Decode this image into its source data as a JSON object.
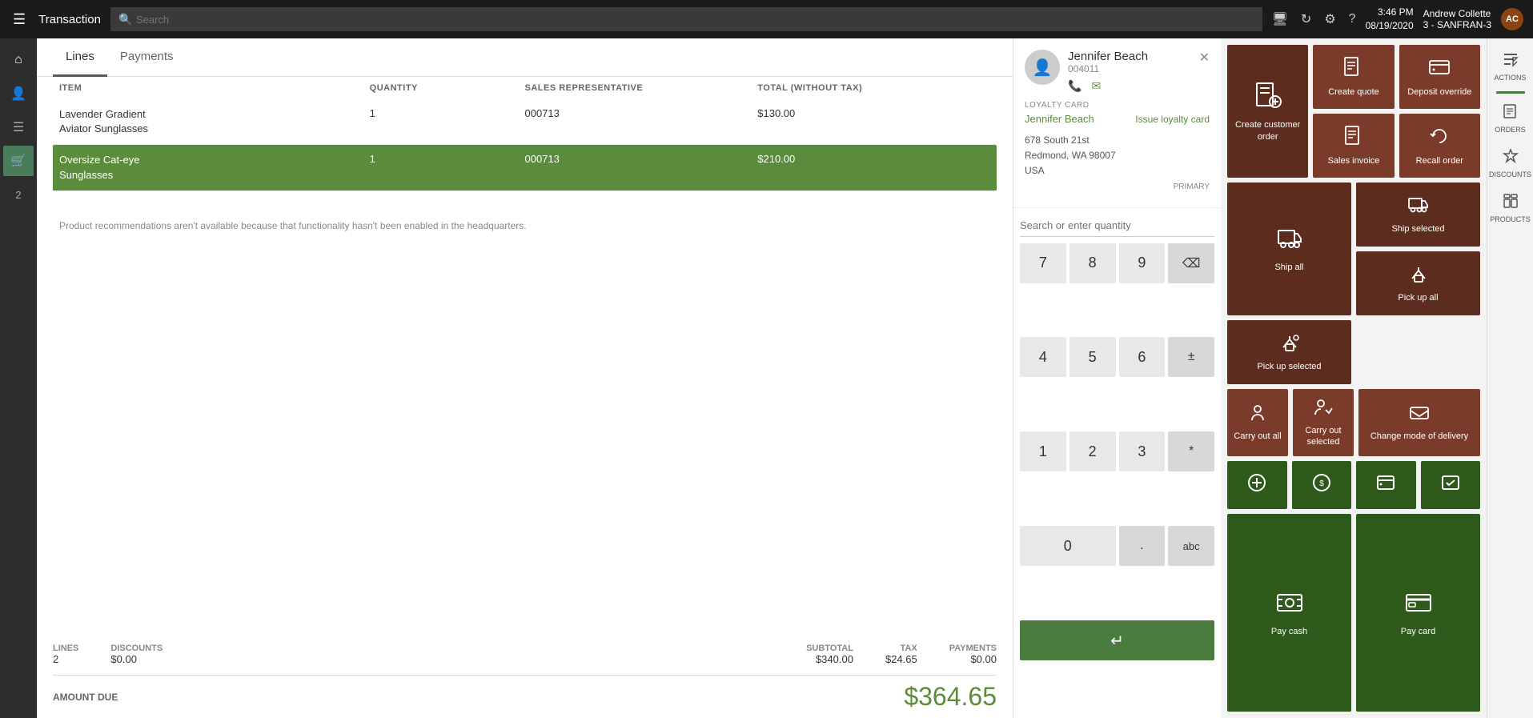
{
  "topbar": {
    "hamburger": "☰",
    "title": "Transaction",
    "search_placeholder": "Search",
    "time": "3:46 PM",
    "date": "08/19/2020",
    "user": "Andrew Collette",
    "store": "3 - SANFRAN-3",
    "avatar": "AC"
  },
  "tabs": [
    {
      "id": "lines",
      "label": "Lines",
      "active": true
    },
    {
      "id": "payments",
      "label": "Payments",
      "active": false
    }
  ],
  "lines_table": {
    "headers": {
      "item": "ITEM",
      "quantity": "QUANTITY",
      "sales_rep": "SALES REPRESENTATIVE",
      "total": "TOTAL (WITHOUT TAX)"
    },
    "rows": [
      {
        "id": 1,
        "item": "Lavender Gradient Aviator Sunglasses",
        "quantity": "1",
        "sales_rep": "000713",
        "total": "$130.00",
        "selected": false
      },
      {
        "id": 2,
        "item": "Oversize Cat-eye Sunglasses",
        "quantity": "1",
        "sales_rep": "000713",
        "total": "$210.00",
        "selected": true
      }
    ]
  },
  "product_rec": "Product recommendations aren't available because that functionality hasn't been enabled in the headquarters.",
  "totals": {
    "lines_label": "LINES",
    "lines_value": "2",
    "discounts_label": "DISCOUNTS",
    "discounts_value": "$0.00",
    "subtotal_label": "SUBTOTAL",
    "subtotal_value": "$340.00",
    "tax_label": "TAX",
    "tax_value": "$24.65",
    "payments_label": "PAYMENTS",
    "payments_value": "$0.00"
  },
  "amount_due": {
    "label": "AMOUNT DUE",
    "value": "$364.65"
  },
  "customer": {
    "name": "Jennifer Beach",
    "id": "004011",
    "loyalty_label": "LOYALTY CARD",
    "loyalty_link": "Issue loyalty card",
    "loyalty_name": "Jennifer Beach",
    "address_line1": "678 South 21st",
    "address_line2": "Redmond, WA 98007",
    "address_line3": "USA",
    "primary": "PRIMARY"
  },
  "numpad": {
    "search_placeholder": "Search or enter quantity",
    "keys": [
      "7",
      "8",
      "9",
      "⌫",
      "4",
      "5",
      "6",
      "±",
      "1",
      "2",
      "3",
      "*",
      "0",
      ".",
      ".",
      "abc"
    ],
    "enter_label": "↵"
  },
  "action_tiles": [
    {
      "id": "create-customer-order",
      "label": "Create customer order",
      "color": "dark-brown",
      "icon": "📋",
      "size": "tall"
    },
    {
      "id": "create-quote",
      "label": "Create quote",
      "color": "brown",
      "icon": "📄",
      "size": "normal"
    },
    {
      "id": "deposit-override",
      "label": "Deposit override",
      "color": "brown",
      "icon": "💳",
      "size": "normal"
    },
    {
      "id": "sales-invoice",
      "label": "Sales invoice",
      "color": "brown",
      "icon": "📑",
      "size": "normal"
    },
    {
      "id": "recall-order",
      "label": "Recall order",
      "color": "brown",
      "icon": "🔄",
      "size": "normal"
    },
    {
      "id": "ship-all",
      "label": "Ship all",
      "color": "dark-brown",
      "icon": "🚚",
      "size": "tall"
    },
    {
      "id": "ship-selected",
      "label": "Ship selected",
      "color": "dark-brown",
      "icon": "📦",
      "size": "normal"
    },
    {
      "id": "pick-up-all",
      "label": "Pick up all",
      "color": "dark-brown",
      "icon": "🛍",
      "size": "normal"
    },
    {
      "id": "pick-up-selected",
      "label": "Pick up selected",
      "color": "dark-brown",
      "icon": "🛒",
      "size": "normal"
    },
    {
      "id": "carry-out-all",
      "label": "Carry out all",
      "color": "brown",
      "icon": "🏃",
      "size": "normal"
    },
    {
      "id": "carry-out-selected",
      "label": "Carry out selected",
      "color": "brown",
      "icon": "🚶",
      "size": "normal"
    },
    {
      "id": "change-mode-delivery",
      "label": "Change mode of delivery",
      "color": "brown",
      "icon": "🔀",
      "size": "wide"
    },
    {
      "id": "pay-cash",
      "label": "Pay cash",
      "color": "dark-green",
      "icon": "💵",
      "size": "tall"
    },
    {
      "id": "pay-card",
      "label": "Pay card",
      "color": "dark-green",
      "icon": "💳",
      "size": "normal"
    }
  ],
  "right_sidebar": {
    "items": [
      {
        "id": "actions",
        "label": "ACTIONS",
        "icon": "⚡"
      },
      {
        "id": "orders",
        "label": "ORDERS",
        "icon": "📋"
      },
      {
        "id": "discounts",
        "label": "DISCOUNTS",
        "icon": "🏷"
      },
      {
        "id": "products",
        "label": "PRODUCTS",
        "icon": "📦"
      }
    ]
  },
  "left_sidebar": {
    "items": [
      {
        "id": "home",
        "icon": "⌂"
      },
      {
        "id": "users",
        "icon": "👤"
      },
      {
        "id": "menu",
        "icon": "☰"
      },
      {
        "id": "cart",
        "icon": "🛒",
        "active": true
      },
      {
        "id": "num",
        "label": "2"
      }
    ]
  }
}
